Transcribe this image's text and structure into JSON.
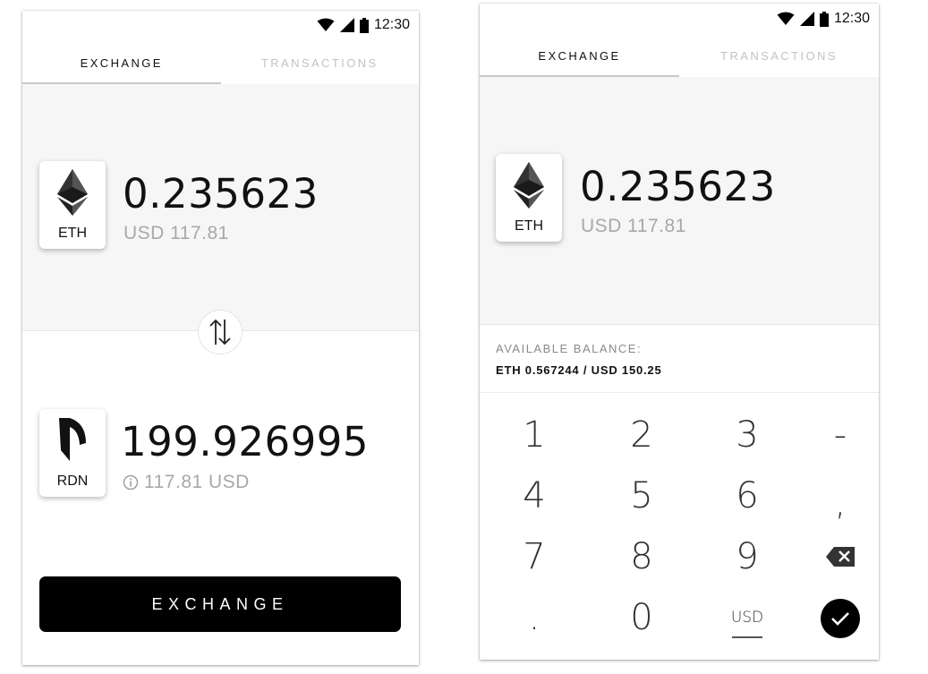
{
  "status_bar": {
    "time": "12:30"
  },
  "tabs": [
    {
      "label": "EXCHANGE"
    },
    {
      "label": "TRANSACTIONS"
    }
  ],
  "exchange_screen": {
    "from": {
      "ticker": "ETH",
      "amount": "0.235623",
      "fiat": "USD 117.81"
    },
    "to": {
      "ticker": "RDN",
      "amount": "199.926995",
      "fiat": "117.81 USD"
    },
    "exchange_button_label": "EXCHANGE"
  },
  "amount_entry_screen": {
    "token": {
      "ticker": "ETH",
      "amount": "0.235623",
      "fiat": "USD 117.81"
    },
    "balance": {
      "label": "AVAILABLE BALANCE:",
      "value": "ETH 0.567244 / USD 150.25"
    },
    "keypad": {
      "keys": [
        "1",
        "2",
        "3",
        "-",
        "4",
        "5",
        "6",
        ",",
        "7",
        "8",
        "9",
        ".",
        "0"
      ],
      "currency_toggle": "USD"
    }
  },
  "icons": {
    "status": [
      "wifi-icon",
      "signal-icon",
      "battery-icon"
    ],
    "swap": "swap-arrows-icon",
    "info": "info-icon",
    "backspace": "backspace-icon",
    "confirm": "checkmark-icon",
    "eth_logo": "ethereum-logo-icon",
    "rdn_logo": "raiden-logo-icon"
  }
}
